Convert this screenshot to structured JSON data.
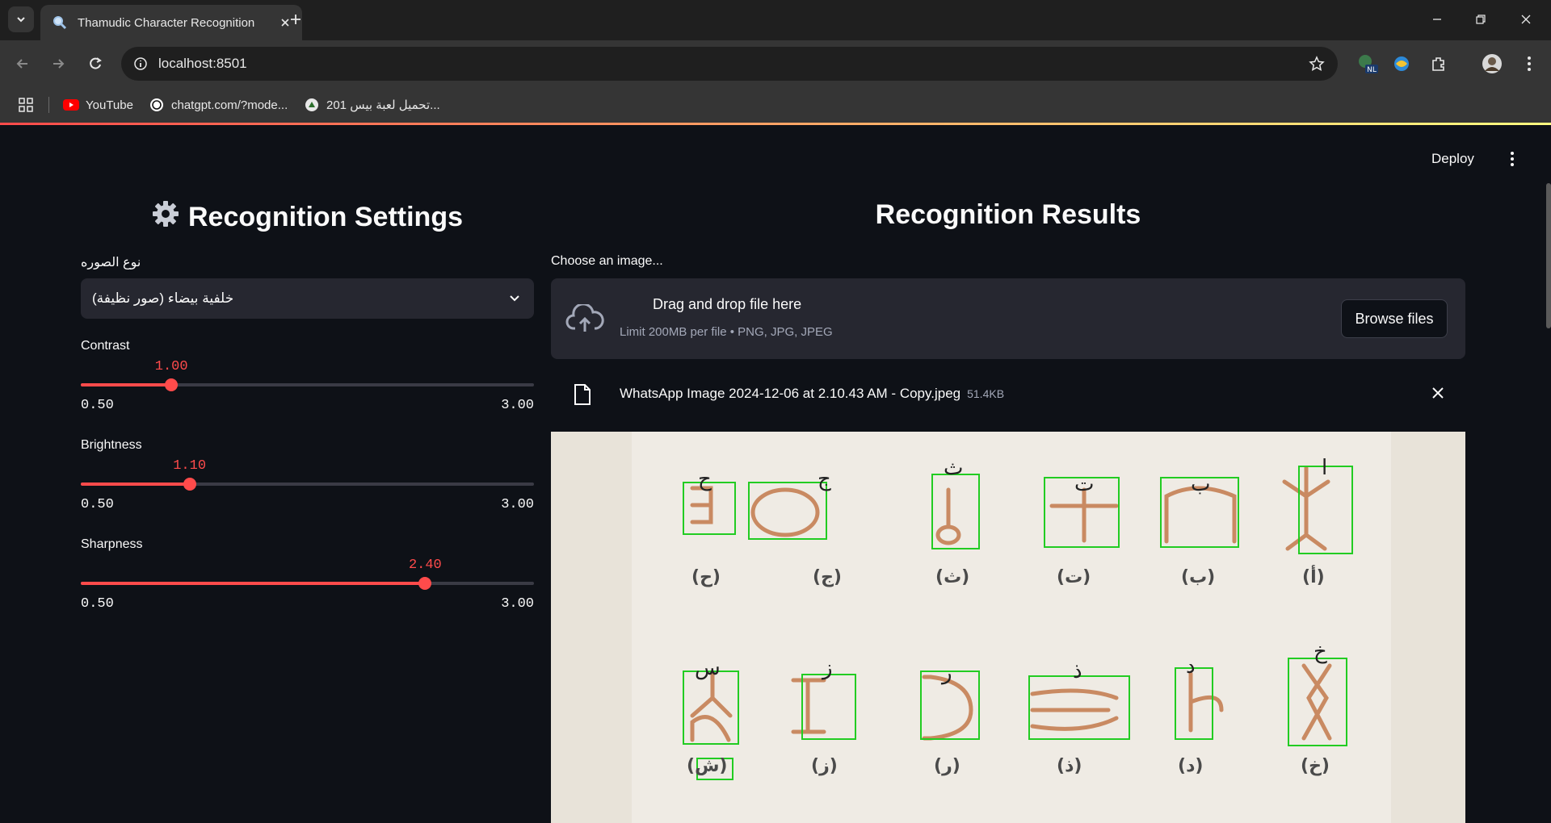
{
  "browser": {
    "tab_title": "Thamudic Character Recognition",
    "url": "localhost:8501",
    "bookmarks": [
      {
        "label": "YouTube",
        "icon": "youtube-icon"
      },
      {
        "label": "chatgpt.com/?mode...",
        "icon": "openai-icon"
      },
      {
        "label": "تحميل لعبة بيس 201...",
        "icon": "site-icon"
      }
    ],
    "extension_badge": "NL"
  },
  "app": {
    "deploy_label": "Deploy",
    "left_header": "Recognition Settings",
    "right_header": "Recognition Results",
    "image_type": {
      "label": "نوع الصوره",
      "selected": "خلفية بيضاء (صور نظيفة)"
    },
    "sliders": [
      {
        "label": "Contrast",
        "value": 1.0,
        "value_text": "1.00",
        "min": 0.5,
        "max": 3.0,
        "min_text": "0.50",
        "max_text": "3.00"
      },
      {
        "label": "Brightness",
        "value": 1.1,
        "value_text": "1.10",
        "min": 0.5,
        "max": 3.0,
        "min_text": "0.50",
        "max_text": "3.00"
      },
      {
        "label": "Sharpness",
        "value": 2.4,
        "value_text": "2.40",
        "min": 0.5,
        "max": 3.0,
        "min_text": "0.50",
        "max_text": "3.00"
      }
    ],
    "uploader": {
      "label": "Choose an image...",
      "drop_text": "Drag and drop file here",
      "limit_text": "Limit 200MB per file • PNG, JPG, JPEG",
      "browse_label": "Browse files"
    },
    "uploaded_file": {
      "name": "WhatsApp Image 2024-12-06 at 2.10.43 AM - Copy.jpeg",
      "size": "51.4KB"
    },
    "preview": {
      "row1_captions": [
        "(ح)",
        "(ج)",
        "(ث)",
        "(ت)",
        "(ب)",
        "(أ)"
      ],
      "row1_glyphs": [
        "ح",
        "ج",
        "ث",
        "ت",
        "ب",
        "ا"
      ],
      "row2_captions": [
        "(ش)",
        "(ز)",
        "(ر)",
        "(ذ)",
        "(د)",
        "(خ)"
      ],
      "row2_glyphs": [
        "س",
        "ز",
        "ر",
        "ذ",
        "د",
        "خ"
      ]
    }
  }
}
